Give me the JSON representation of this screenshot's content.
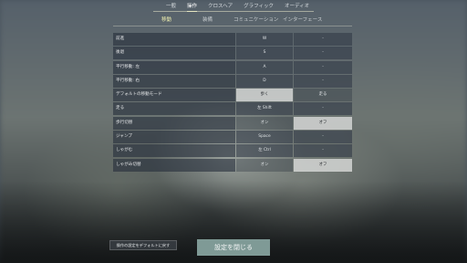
{
  "top_tabs": [
    "一般",
    "操作",
    "クロスヘア",
    "グラフィック",
    "オーディオ"
  ],
  "sub_tabs": [
    "移動",
    "装備",
    "コミュニケーション",
    "インターフェース"
  ],
  "rows": [
    {
      "label": "前進",
      "primary": "W",
      "secondary": "-"
    },
    {
      "label": "後退",
      "primary": "S",
      "secondary": "-"
    },
    {
      "label": "平行移動: 左",
      "primary": "A",
      "secondary": "-"
    },
    {
      "label": "平行移動: 右",
      "primary": "D",
      "secondary": "-"
    },
    {
      "label": "デフォルトの移動モード",
      "primary": "歩く",
      "secondary": "走る"
    },
    {
      "label": "走る",
      "primary": "左 Shift",
      "secondary": "-"
    },
    {
      "label": "歩行切替",
      "primary": "オン",
      "secondary": "オフ"
    },
    {
      "label": "ジャンプ",
      "primary": "Space",
      "secondary": "-"
    },
    {
      "label": "しゃがむ",
      "primary": "左 Ctrl",
      "secondary": "-"
    },
    {
      "label": "しゃがみ切替",
      "primary": "オン",
      "secondary": "オフ"
    }
  ],
  "buttons": {
    "reset": "操作の設定をデフォルトに戻す",
    "close": "設定を閉じる"
  },
  "colors": {
    "accent_tab": "#f0f0b0",
    "selected_option": "#dcdedc",
    "close_button": "#7f9a96"
  }
}
